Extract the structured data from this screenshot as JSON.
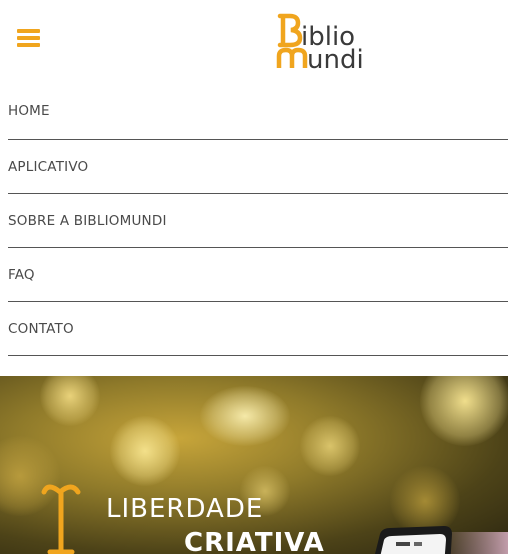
{
  "brand": {
    "line1": "Biblio",
    "line2": "mundi",
    "accent": "#f0a51e",
    "text_color": "#3a3a3a"
  },
  "header": {
    "menu_icon": "hamburger-icon"
  },
  "nav": {
    "items": [
      {
        "label": "HOME"
      },
      {
        "label": "APLICATIVO"
      },
      {
        "label": "SOBRE A BIBLIOMUNDI"
      },
      {
        "label": "FAQ"
      },
      {
        "label": "CONTATO"
      }
    ]
  },
  "hero": {
    "line1": "LIBERDADE",
    "line2": "CRIATIVA",
    "glyph_icon": "bibliomundi-symbol-icon",
    "device_icon": "tablet-icon"
  }
}
